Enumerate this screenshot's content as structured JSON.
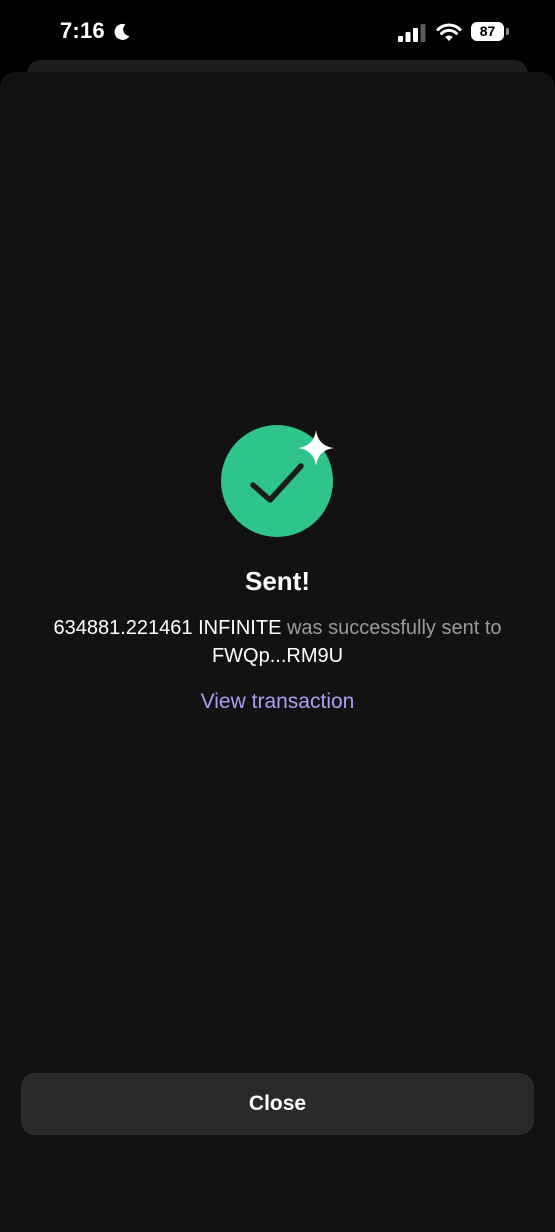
{
  "status_bar": {
    "time": "7:16",
    "battery_level": "87",
    "icons": [
      "moon-icon",
      "signal-icon",
      "wifi-icon",
      "battery-icon"
    ]
  },
  "result": {
    "icon": "check-icon",
    "icon_color": "#2ec48a",
    "title": "Sent!",
    "amount": "634881.221461 INFINITE",
    "message_mid": "was successfully sent to",
    "recipient": "FWQp...RM9U",
    "view_link_label": "View transaction",
    "link_color": "#ab9ff2"
  },
  "footer": {
    "close_label": "Close"
  }
}
